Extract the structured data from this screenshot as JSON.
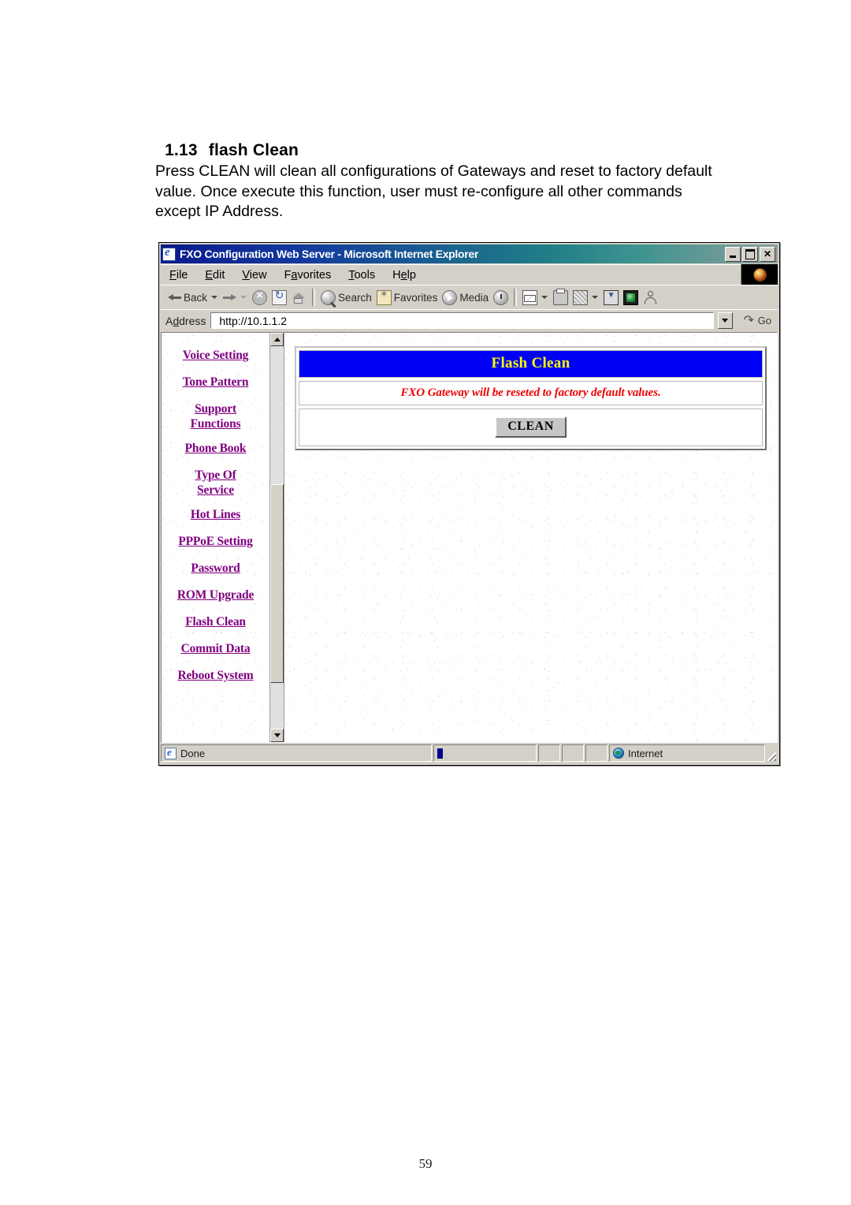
{
  "document": {
    "section_number": "1.13",
    "section_title": "flash Clean",
    "paragraph": "Press CLEAN will clean all configurations of Gateways and reset to factory default value. Once execute this function, user must re-configure all other commands except IP Address.",
    "page_number": "59"
  },
  "browser": {
    "title": "FXO Configuration Web Server - Microsoft Internet Explorer",
    "title_icon": "ie-document-icon",
    "window_controls": {
      "minimize": "minimize-icon",
      "maximize": "maximize-icon",
      "close": "✕"
    },
    "menu": [
      {
        "label": "File",
        "accel": "F",
        "rest": "ile"
      },
      {
        "label": "Edit",
        "accel": "E",
        "rest": "dit"
      },
      {
        "label": "View",
        "accel": "V",
        "rest": "iew"
      },
      {
        "label": "Favorites",
        "pre": "F",
        "accel": "a",
        "rest": "vorites"
      },
      {
        "label": "Tools",
        "accel": "T",
        "rest": "ools"
      },
      {
        "label": "Help",
        "pre": "H",
        "accel": "e",
        "rest": "lp"
      }
    ],
    "toolbar": {
      "back_label": "Back",
      "buttons": [
        "back-button",
        "forward-button",
        "stop-button",
        "refresh-button",
        "home-button",
        "search-button",
        "favorites-button",
        "media-button",
        "history-button",
        "mail-button",
        "print-button",
        "edit-button",
        "discuss-button",
        "messenger-button",
        "contacts-button"
      ],
      "search_label": "Search",
      "favorites_label": "Favorites",
      "media_label": "Media"
    },
    "address": {
      "label": "Address",
      "label_pre": "A",
      "label_accel": "d",
      "label_rest": "dress",
      "url": "http://10.1.1.2",
      "placeholder": "http://",
      "go_label": "Go"
    },
    "statusbar": {
      "status_text": "Done",
      "zone_text": "Internet"
    }
  },
  "webpage": {
    "nav": {
      "items": [
        {
          "label": "Voice Setting"
        },
        {
          "label": "Tone Pattern"
        },
        {
          "label": "Support Functions",
          "line1": "Support",
          "line2": "Functions"
        },
        {
          "label": "Phone Book"
        },
        {
          "label": "Type Of Service",
          "line1": "Type Of",
          "line2": "Service"
        },
        {
          "label": "Hot Lines"
        },
        {
          "label": "PPPoE Setting"
        },
        {
          "label": "Password"
        },
        {
          "label": "ROM Upgrade"
        },
        {
          "label": "Flash Clean"
        },
        {
          "label": "Commit Data"
        },
        {
          "label": "Reboot System"
        }
      ]
    },
    "panel": {
      "title": "Flash Clean",
      "warning": "FXO Gateway will be reseted to factory default values.",
      "button_label": "CLEAN"
    },
    "colors": {
      "panel_title_bg": "#0000f5",
      "panel_title_fg": "#ffff00",
      "warning_fg": "#ee0000",
      "link": "#800080"
    }
  }
}
